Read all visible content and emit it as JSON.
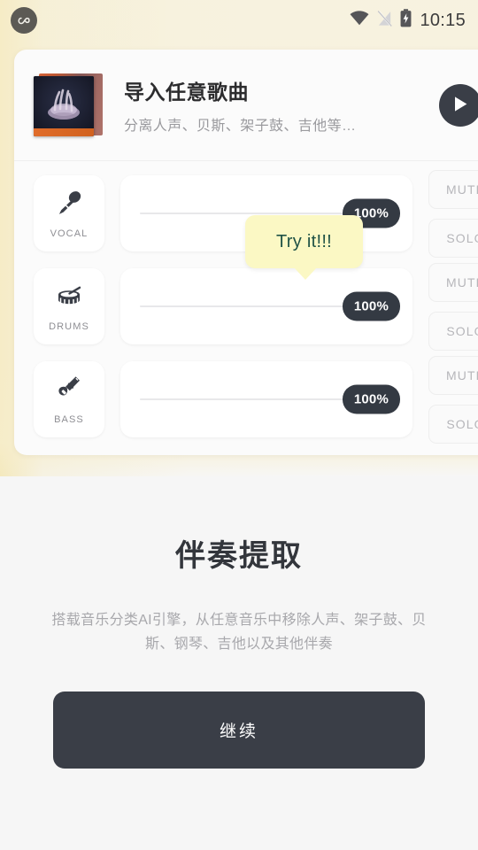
{
  "status_bar": {
    "logo_icon": "app-logo-icon",
    "wifi_icon": "wifi-icon",
    "signal_icon": "signal-off-icon",
    "battery_icon": "battery-charging-icon",
    "time": "10:15"
  },
  "header": {
    "album_art_icon": "album-artwork",
    "title": "导入任意歌曲",
    "subtitle": "分离人声、贝斯、架子鼓、吉他等…",
    "play_icon": "play-icon"
  },
  "tracks": [
    {
      "icon": "microphone-icon",
      "label": "VOCAL",
      "volume": "100%",
      "mute_label": "MUTE",
      "solo_label": "SOLO"
    },
    {
      "icon": "drums-icon",
      "label": "DRUMS",
      "volume": "100%",
      "mute_label": "MUTE",
      "solo_label": "SOLO"
    },
    {
      "icon": "bass-guitar-icon",
      "label": "BASS",
      "volume": "100%",
      "mute_label": "MUTE",
      "solo_label": "SOLO"
    }
  ],
  "tooltip": {
    "text": "Try it!!!",
    "background": "#fbf8c4",
    "text_color": "#1f5245"
  },
  "promo": {
    "title": "伴奏提取",
    "description": "搭载音乐分类AI引擎，从任意音乐中移除人声、架子鼓、贝斯、钢琴、吉他以及其他伴奏"
  },
  "cta": {
    "label": "继续",
    "background": "#3a3e47"
  },
  "colors": {
    "page_background": "#f6f6f6",
    "warm_accent": "#f4e8ba",
    "dark": "#3a3e47",
    "badge": "#343a43"
  }
}
